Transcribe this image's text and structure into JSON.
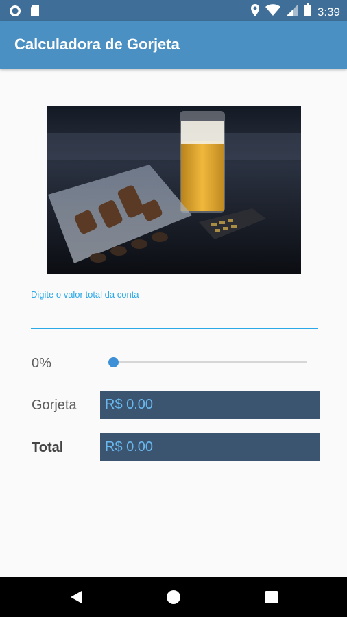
{
  "status_bar": {
    "time": "3:39",
    "left_icons": [
      "record-icon",
      "sd-card-icon"
    ],
    "right_icons": [
      "location-icon",
      "wifi-icon",
      "signal-icon",
      "battery-icon"
    ]
  },
  "app_bar": {
    "title": "Calculadora de Gorjeta"
  },
  "header_image": {
    "description_icon": "beer-coins-calculator-photo"
  },
  "bill_input": {
    "label": "Digite o valor total da conta",
    "value": ""
  },
  "tip_slider": {
    "percent_label": "0%",
    "value": 0
  },
  "tip_row": {
    "label": "Gorjeta",
    "value": "R$ 0.00"
  },
  "total_row": {
    "label": "Total",
    "value": "R$ 0.00"
  },
  "nav_bar": {
    "buttons": [
      "back-icon",
      "home-icon",
      "recents-icon"
    ]
  },
  "colors": {
    "primary": "#4a90c2",
    "status_bar": "#3f6f98",
    "accent": "#2aa8e8",
    "value_box": "#3b5570",
    "value_text": "#69b8ef"
  }
}
